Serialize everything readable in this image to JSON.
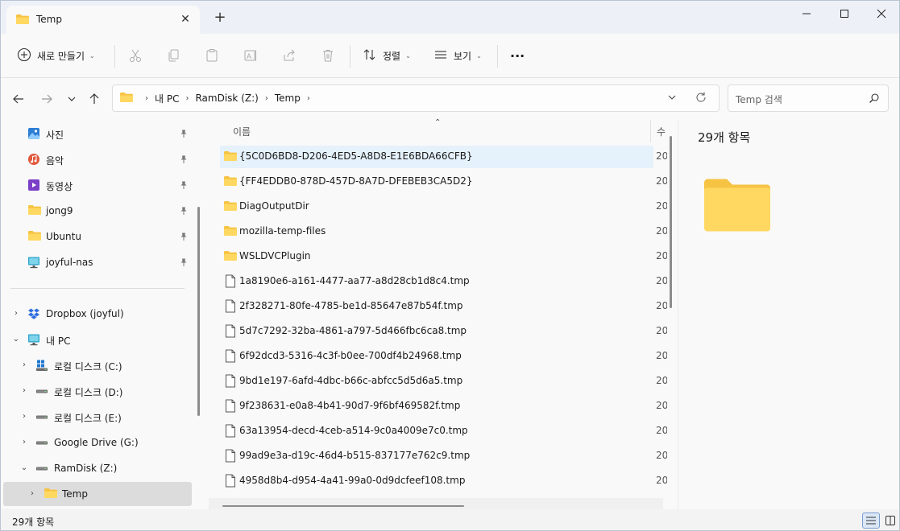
{
  "window": {
    "tab_title": "Temp",
    "new_tab_symbol": "+"
  },
  "toolbar": {
    "new_label": "새로 만들기",
    "sort_label": "정렬",
    "view_label": "보기",
    "more_label": "···"
  },
  "address": {
    "crumbs": [
      "내 PC",
      "RamDisk (Z:)",
      "Temp"
    ],
    "search_placeholder": "Temp 검색"
  },
  "sidebar": {
    "quick_access": [
      {
        "label": "사진",
        "icon": "photos-icon"
      },
      {
        "label": "음악",
        "icon": "music-icon"
      },
      {
        "label": "동영상",
        "icon": "videos-icon"
      },
      {
        "label": "jong9",
        "icon": "folder-icon"
      },
      {
        "label": "Ubuntu",
        "icon": "folder-icon"
      },
      {
        "label": "joyful-nas",
        "icon": "network-icon"
      }
    ],
    "tree": [
      {
        "label": "Dropbox (joyful)",
        "expander": "›",
        "icon": "dropbox-icon"
      },
      {
        "label": "내 PC",
        "expander": "⌄",
        "icon": "pc-icon"
      },
      {
        "label": "로컬 디스크 (C:)",
        "expander": "›",
        "icon": "windows-drive-icon"
      },
      {
        "label": "로컬 디스크 (D:)",
        "expander": "›",
        "icon": "drive-icon"
      },
      {
        "label": "로컬 디스크 (E:)",
        "expander": "›",
        "icon": "drive-icon"
      },
      {
        "label": "Google Drive (G:)",
        "expander": "›",
        "icon": "drive-icon"
      },
      {
        "label": "RamDisk (Z:)",
        "expander": "⌄",
        "icon": "drive-icon"
      },
      {
        "label": "Temp",
        "expander": "›",
        "icon": "folder-icon",
        "selected": true
      }
    ]
  },
  "list": {
    "col_name": "이름",
    "col_date": "수",
    "sort_arrow": "⌃",
    "items": [
      {
        "name": "{5C0D6BD8-D206-4ED5-A8D8-E1E6BDA66CFB}",
        "type": "folder",
        "date": "20",
        "selected": true
      },
      {
        "name": "{FF4EDDB0-878D-457D-8A7D-DFEBEB3CA5D2}",
        "type": "folder",
        "date": "20"
      },
      {
        "name": "DiagOutputDir",
        "type": "folder",
        "date": "20"
      },
      {
        "name": "mozilla-temp-files",
        "type": "folder",
        "date": "20"
      },
      {
        "name": "WSLDVCPlugin",
        "type": "folder",
        "date": "20"
      },
      {
        "name": "1a8190e6-a161-4477-aa77-a8d28cb1d8c4.tmp",
        "type": "file",
        "date": "20"
      },
      {
        "name": "2f328271-80fe-4785-be1d-85647e87b54f.tmp",
        "type": "file",
        "date": "20"
      },
      {
        "name": "5d7c7292-32ba-4861-a797-5d466fbc6ca8.tmp",
        "type": "file",
        "date": "20"
      },
      {
        "name": "6f92dcd3-5316-4c3f-b0ee-700df4b24968.tmp",
        "type": "file",
        "date": "20"
      },
      {
        "name": "9bd1e197-6afd-4dbc-b66c-abfcc5d5d6a5.tmp",
        "type": "file",
        "date": "20"
      },
      {
        "name": "9f238631-e0a8-4b41-90d7-9f6bf469582f.tmp",
        "type": "file",
        "date": "20"
      },
      {
        "name": "63a13954-decd-4ceb-a514-9c0a4009e7c0.tmp",
        "type": "file",
        "date": "20"
      },
      {
        "name": "99ad9e3a-d19c-46d4-b515-837177e762c9.tmp",
        "type": "file",
        "date": "20"
      },
      {
        "name": "4958d8b4-d954-4a41-99a0-0d9dcfeef108.tmp",
        "type": "file",
        "date": "20"
      }
    ]
  },
  "details": {
    "count": "29개 항목"
  },
  "status": {
    "count": "29개 항목"
  }
}
